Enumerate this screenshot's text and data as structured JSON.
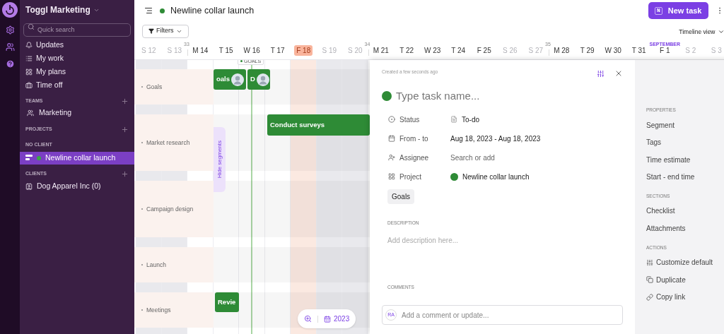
{
  "workspace": {
    "name": "Toggl Marketing"
  },
  "search": {
    "placeholder": "Quick search"
  },
  "nav": [
    "Updates",
    "My work",
    "My plans",
    "Time off"
  ],
  "teams": {
    "title": "TEAMS",
    "items": [
      "Marketing"
    ]
  },
  "projects": {
    "title": "PROJECTS",
    "groups": [
      {
        "title": "NO CLIENT",
        "items": [
          {
            "label": "Newline collar launch",
            "selected": true
          }
        ]
      }
    ]
  },
  "clients": {
    "title": "CLIENTS",
    "items": [
      "Dog Apparel Inc (0)"
    ]
  },
  "header": {
    "title": "Newline collar launch",
    "new_task": {
      "label": "New task",
      "shortcut": "N"
    },
    "filters": "Filters",
    "view": "Timeline view"
  },
  "days": [
    {
      "label": "S 12",
      "weekend": true,
      "today": false
    },
    {
      "label": "S 13",
      "weekend": true,
      "today": false
    },
    {
      "label": "M 14",
      "weekend": false,
      "today": false,
      "week": "33"
    },
    {
      "label": "T 15",
      "weekend": false,
      "today": false
    },
    {
      "label": "W 16",
      "weekend": false,
      "today": false,
      "marker": "GOALS"
    },
    {
      "label": "T 17",
      "weekend": false,
      "today": false
    },
    {
      "label": "F 18",
      "weekend": false,
      "today": true
    },
    {
      "label": "S 19",
      "weekend": true,
      "today": false
    },
    {
      "label": "S 20",
      "weekend": true,
      "today": false
    },
    {
      "label": "M 21",
      "weekend": false,
      "today": false,
      "week": "34"
    },
    {
      "label": "T 22",
      "weekend": false,
      "today": false
    },
    {
      "label": "W 23",
      "weekend": false,
      "today": false
    },
    {
      "label": "T 24",
      "weekend": false,
      "today": false
    },
    {
      "label": "F 25",
      "weekend": false,
      "today": false
    },
    {
      "label": "S 26",
      "weekend": true,
      "today": false
    },
    {
      "label": "S 27",
      "weekend": true,
      "today": false
    },
    {
      "label": "M 28",
      "weekend": false,
      "today": false,
      "week": "35"
    },
    {
      "label": "T 29",
      "weekend": false,
      "today": false
    },
    {
      "label": "W 30",
      "weekend": false,
      "today": false
    },
    {
      "label": "T 31",
      "weekend": false,
      "today": false
    },
    {
      "label": "F 1",
      "weekend": false,
      "today": false,
      "month": "SEPTEMBER"
    },
    {
      "label": "S 2",
      "weekend": true,
      "today": false
    },
    {
      "label": "S 3",
      "weekend": true,
      "today": false
    }
  ],
  "segments": [
    {
      "label": "Goals",
      "tasks": [
        {
          "label": "oals",
          "avatar": true
        },
        {
          "label": "D",
          "avatar": true
        }
      ]
    },
    {
      "label": "Market research",
      "tasks": [
        {
          "label": "Conduct surveys",
          "avatar": false
        }
      ]
    },
    {
      "label": "Campaign design"
    },
    {
      "label": "Launch"
    },
    {
      "label": "Meetings",
      "tasks": [
        {
          "label": "Revie",
          "avatar": false
        }
      ]
    }
  ],
  "hide_segments": "Hide segments",
  "zoom_bar": {
    "year": "2023"
  },
  "task_panel": {
    "created": "Created a few seconds ago",
    "name_placeholder": "Type task name...",
    "fields": [
      {
        "kind": "status",
        "label": "Status",
        "value": "To-do"
      },
      {
        "kind": "date",
        "label": "From - to",
        "value": "Aug 18, 2023 - Aug 18, 2023"
      },
      {
        "kind": "person",
        "label": "Assignee",
        "placeholder": "Search or add"
      },
      {
        "kind": "project",
        "label": "Project",
        "value": "Newline collar launch"
      }
    ],
    "tag": "Goals",
    "description": {
      "title": "DESCRIPTION",
      "placeholder": "Add description here..."
    },
    "comments": {
      "title": "COMMENTS",
      "avatar": "RA",
      "placeholder": "Add a comment or update..."
    },
    "side": [
      {
        "title": "PROPERTIES",
        "items": [
          "Segment",
          "Tags",
          "Time estimate",
          "Start - end time"
        ]
      },
      {
        "title": "SECTIONS",
        "items": [
          "Checklist",
          "Attachments"
        ]
      },
      {
        "title": "ACTIONS",
        "items": [
          "Customize default",
          "Duplicate",
          "Copy link"
        ]
      }
    ]
  }
}
